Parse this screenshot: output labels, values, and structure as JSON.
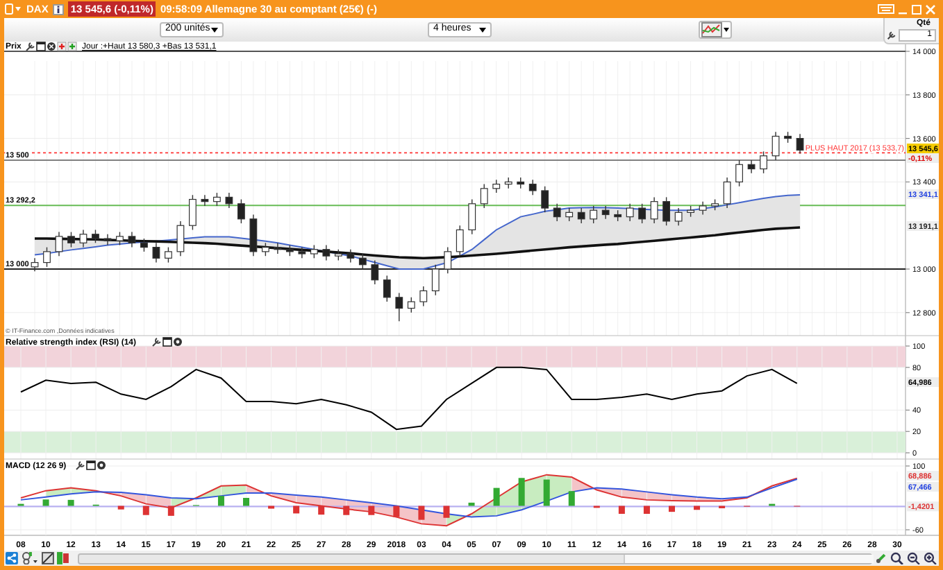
{
  "title_bar": {
    "symbol": "DAX",
    "quote": "13 545,6 (-0,11%)",
    "description": "09:58:09 Allemagne 30 au comptant (25€) (-)"
  },
  "toolbar": {
    "units": "200 unités",
    "period": "4 heures",
    "quantity_label": "Qté",
    "quantity": "1"
  },
  "price_pane": {
    "legend_label": "Prix",
    "legend_text": "Jour :+Haut 13 580,3 +Bas 13 531,1",
    "source_note": "© IT-Finance.com ,Données indicatives",
    "axis_tags": [
      {
        "kind": "last",
        "label": "13 545,6"
      },
      {
        "kind": "change",
        "label": "-0,11%"
      },
      {
        "kind": "ma_fast",
        "label": "13 341,1"
      },
      {
        "kind": "ma_slow",
        "label": "13 191,1"
      }
    ],
    "chart_data": {
      "type": "candlestick",
      "grid": true,
      "ylim": [
        12800,
        14000
      ],
      "categories": [
        null,
        null,
        null,
        null,
        null,
        null,
        null,
        null,
        null,
        null,
        null,
        null,
        null,
        null,
        null,
        null,
        null,
        null,
        null,
        null,
        null,
        null,
        null,
        null,
        null,
        null,
        null,
        null,
        null,
        null,
        null,
        null,
        null,
        null,
        null,
        null,
        null,
        null,
        null,
        null,
        null,
        null,
        null,
        null,
        null,
        null,
        null,
        null,
        null,
        null,
        null,
        null,
        null,
        null,
        null,
        null,
        null,
        null,
        null,
        null,
        null,
        null,
        null,
        null,
        null,
        null,
        null,
        null,
        null,
        null,
        null,
        null
      ],
      "yticks": [
        {
          "value": 14000,
          "label": "14 000"
        },
        {
          "value": 13800,
          "label": "13 800"
        },
        {
          "value": 13600,
          "label": "13 600"
        },
        {
          "value": 13400,
          "label": "13 400"
        },
        {
          "value": 13000,
          "label": "13 000"
        },
        {
          "value": 12800,
          "label": "12 800"
        }
      ],
      "ohlc": [
        [
          13010,
          13050,
          12990,
          13030
        ],
        [
          13030,
          13100,
          13010,
          13080
        ],
        [
          13080,
          13170,
          13060,
          13150
        ],
        [
          13150,
          13170,
          13100,
          13120
        ],
        [
          13120,
          13180,
          13100,
          13160
        ],
        [
          13160,
          13180,
          13120,
          13140
        ],
        [
          13140,
          13160,
          13110,
          13130
        ],
        [
          13130,
          13170,
          13110,
          13150
        ],
        [
          13150,
          13170,
          13100,
          13120
        ],
        [
          13120,
          13140,
          13080,
          13100
        ],
        [
          13100,
          13120,
          13030,
          13050
        ],
        [
          13050,
          13100,
          13030,
          13080
        ],
        [
          13080,
          13220,
          13060,
          13200
        ],
        [
          13200,
          13340,
          13180,
          13320
        ],
        [
          13320,
          13340,
          13290,
          13310
        ],
        [
          13310,
          13350,
          13290,
          13330
        ],
        [
          13330,
          13350,
          13280,
          13300
        ],
        [
          13300,
          13320,
          13210,
          13230
        ],
        [
          13230,
          13250,
          13060,
          13080
        ],
        [
          13080,
          13120,
          13060,
          13100
        ],
        [
          13100,
          13120,
          13070,
          13090
        ],
        [
          13090,
          13110,
          13060,
          13080
        ],
        [
          13080,
          13100,
          13050,
          13070
        ],
        [
          13070,
          13110,
          13050,
          13090
        ],
        [
          13090,
          13110,
          13040,
          13060
        ],
        [
          13060,
          13090,
          13040,
          13070
        ],
        [
          13070,
          13090,
          13030,
          13050
        ],
        [
          13050,
          13070,
          13000,
          13020
        ],
        [
          13020,
          13040,
          12930,
          12950
        ],
        [
          12950,
          12970,
          12850,
          12870
        ],
        [
          12870,
          12890,
          12760,
          12820
        ],
        [
          12820,
          12870,
          12800,
          12850
        ],
        [
          12850,
          12920,
          12830,
          12900
        ],
        [
          12900,
          13020,
          12880,
          13000
        ],
        [
          13000,
          13100,
          12980,
          13080
        ],
        [
          13080,
          13200,
          13060,
          13180
        ],
        [
          13180,
          13320,
          13160,
          13300
        ],
        [
          13300,
          13390,
          13280,
          13370
        ],
        [
          13370,
          13410,
          13350,
          13390
        ],
        [
          13390,
          13420,
          13370,
          13400
        ],
        [
          13400,
          13420,
          13370,
          13390
        ],
        [
          13390,
          13410,
          13340,
          13360
        ],
        [
          13360,
          13380,
          13260,
          13280
        ],
        [
          13280,
          13300,
          13220,
          13240
        ],
        [
          13240,
          13280,
          13220,
          13260
        ],
        [
          13260,
          13280,
          13210,
          13230
        ],
        [
          13230,
          13290,
          13210,
          13270
        ],
        [
          13270,
          13290,
          13230,
          13250
        ],
        [
          13250,
          13270,
          13220,
          13240
        ],
        [
          13240,
          13300,
          13220,
          13280
        ],
        [
          13280,
          13300,
          13210,
          13230
        ],
        [
          13230,
          13330,
          13210,
          13310
        ],
        [
          13310,
          13330,
          13200,
          13220
        ],
        [
          13220,
          13280,
          13200,
          13260
        ],
        [
          13260,
          13290,
          13240,
          13270
        ],
        [
          13270,
          13310,
          13250,
          13290
        ],
        [
          13290,
          13320,
          13270,
          13300
        ],
        [
          13300,
          13420,
          13280,
          13400
        ],
        [
          13400,
          13500,
          13380,
          13480
        ],
        [
          13480,
          13500,
          13440,
          13460
        ],
        [
          13460,
          13540,
          13440,
          13520
        ],
        [
          13520,
          13630,
          13500,
          13610
        ],
        [
          13610,
          13630,
          13580,
          13600
        ],
        [
          13600,
          13620,
          13530,
          13546
        ],
        null,
        null,
        null,
        null,
        null,
        null,
        null,
        null
      ],
      "series": [
        {
          "type": "line",
          "color": "#4466cc",
          "values": [
            13065,
            13072,
            13080,
            13088,
            13095,
            13102,
            13110,
            13115,
            13120,
            13124,
            13128,
            13133,
            13138,
            13143,
            13148,
            13148,
            13148,
            13142,
            13135,
            13128,
            13120,
            13110,
            13100,
            13090,
            13080,
            13070,
            13060,
            13045,
            13030,
            13015,
            13000,
            13000,
            13000,
            13015,
            13030,
            13060,
            13090,
            13135,
            13180,
            13210,
            13240,
            13252,
            13265,
            13272,
            13280,
            13282,
            13283,
            13282,
            13280,
            13278,
            13275,
            13272,
            13270,
            13270,
            13270,
            13278,
            13285,
            13295,
            13305,
            13315,
            13325,
            13333,
            13338,
            13341,
            null,
            null,
            null,
            null,
            null,
            null,
            null,
            null
          ]
        },
        {
          "type": "line",
          "color": "#111111",
          "values": [
            13140,
            13140,
            13139,
            13138,
            13137,
            13136,
            13134,
            13132,
            13130,
            13128,
            13127,
            13125,
            13123,
            13121,
            13119,
            13116,
            13112,
            13108,
            13104,
            13100,
            13096,
            13092,
            13088,
            13084,
            13080,
            13076,
            13072,
            13067,
            13062,
            13058,
            13054,
            13052,
            13050,
            13052,
            13055,
            13058,
            13062,
            13066,
            13070,
            13075,
            13080,
            13085,
            13090,
            13095,
            13100,
            13104,
            13108,
            13112,
            13115,
            13120,
            13125,
            13130,
            13135,
            13140,
            13145,
            13150,
            13155,
            13162,
            13168,
            13174,
            13180,
            13185,
            13188,
            13191,
            null,
            null,
            null,
            null,
            null,
            null,
            null,
            null
          ]
        }
      ],
      "ref_lines": [
        {
          "axis": "y",
          "value": 14000,
          "color": "#555555"
        },
        {
          "axis": "y",
          "value": 13533.7,
          "color": "#ff3333",
          "label": "PLUS HAUT 2017 (13 533,7)"
        },
        {
          "axis": "y",
          "value": 13500,
          "color": "#808080",
          "label": "13 500"
        },
        {
          "axis": "y",
          "value": 13292.2,
          "color": "#66bb55",
          "label": "13 292,2"
        },
        {
          "axis": "y",
          "value": 13000,
          "color": "#222222",
          "label": "13 000"
        }
      ]
    }
  },
  "rsi_pane": {
    "legend": "Relative strength index (RSI) (14)",
    "axis_tag": "64,986",
    "chart_data": {
      "type": "line",
      "grid": true,
      "ylim": [
        0,
        100
      ],
      "categories": [
        null,
        null,
        null,
        null,
        null,
        null,
        null,
        null,
        null,
        null,
        null,
        null,
        null,
        null,
        null,
        null,
        null,
        null,
        null,
        null,
        null,
        null,
        null,
        null,
        null,
        null,
        null,
        null,
        null,
        null,
        null,
        null,
        null,
        null,
        null,
        null
      ],
      "yticks": [
        100,
        80,
        40,
        20,
        0
      ],
      "series": [
        {
          "color": "#000000",
          "values": [
            57,
            68,
            65,
            66,
            55,
            50,
            62,
            78,
            70,
            48,
            48,
            46,
            50,
            45,
            38,
            22,
            25,
            50,
            65,
            80,
            80,
            78,
            50,
            50,
            52,
            55,
            50,
            55,
            58,
            72,
            78,
            65,
            null,
            null,
            null,
            null
          ]
        }
      ],
      "bands": [
        {
          "axis": "y",
          "from": 80,
          "to": 100,
          "color": "#f2d3da"
        },
        {
          "axis": "y",
          "from": 0,
          "to": 20,
          "color": "#d9f0d9"
        }
      ]
    }
  },
  "macd_pane": {
    "legend": "MACD (12 26 9)",
    "axis_tags": [
      {
        "kind": "macd",
        "label": "68,886"
      },
      {
        "kind": "signal",
        "label": "67,466"
      }
    ],
    "chart_data": {
      "type": "line",
      "grid": true,
      "ylim": [
        -60,
        100
      ],
      "categories": [
        "08",
        "10",
        "12",
        "13",
        "14",
        "15",
        "17",
        "19",
        "20",
        "21",
        "22",
        "25",
        "27",
        "28",
        "29",
        "2018",
        "03",
        "04",
        "05",
        "07",
        "09",
        "10",
        "11",
        "12",
        "14",
        "16",
        "17",
        "18",
        "19",
        "21",
        "23",
        "24",
        "25",
        "26",
        "28",
        "30"
      ],
      "yticks": [
        100,
        -60
      ],
      "series": [
        {
          "color": "#dd3333",
          "values": [
            20,
            38,
            45,
            38,
            25,
            5,
            -5,
            20,
            50,
            52,
            25,
            8,
            0,
            -8,
            -15,
            -28,
            -45,
            -50,
            -20,
            20,
            60,
            78,
            72,
            40,
            22,
            15,
            13,
            12,
            12,
            20,
            50,
            69,
            null,
            null,
            null,
            null
          ]
        },
        {
          "color": "#3355dd",
          "values": [
            15,
            22,
            30,
            35,
            34,
            28,
            20,
            18,
            25,
            32,
            32,
            27,
            22,
            15,
            8,
            0,
            -10,
            -20,
            -28,
            -25,
            -10,
            12,
            35,
            45,
            42,
            35,
            28,
            22,
            18,
            22,
            45,
            67,
            null,
            null,
            null,
            null
          ]
        },
        {
          "type": "bar",
          "color": "#33aa33",
          "values": [
            5,
            16,
            15,
            3,
            null,
            null,
            null,
            2,
            25,
            20,
            null,
            null,
            null,
            null,
            null,
            null,
            null,
            null,
            8,
            45,
            70,
            66,
            37,
            null,
            null,
            null,
            null,
            null,
            null,
            null,
            5,
            null,
            null,
            null,
            null,
            null
          ]
        },
        {
          "type": "bar",
          "color": "#dd3333",
          "values": [
            null,
            null,
            null,
            null,
            -9,
            -23,
            -25,
            null,
            null,
            null,
            -7,
            -19,
            -22,
            -23,
            -23,
            -28,
            -35,
            -30,
            null,
            null,
            null,
            null,
            null,
            -5,
            -20,
            -20,
            -15,
            -10,
            -6,
            -2,
            null,
            -1,
            null,
            null,
            null,
            null
          ]
        }
      ],
      "ref_lines": [
        {
          "axis": "y",
          "value": -1.4201,
          "color": "#b8b0f0",
          "label": "-1,4201"
        }
      ]
    }
  }
}
